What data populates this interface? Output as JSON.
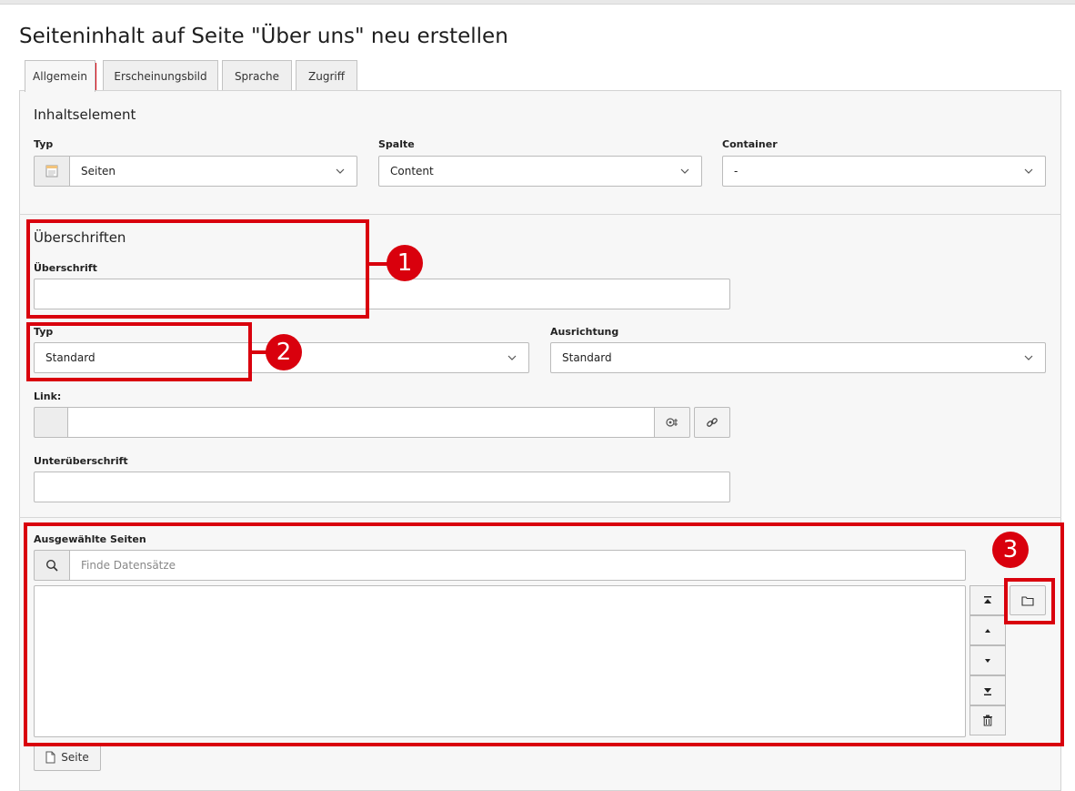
{
  "page": {
    "title": "Seiteninhalt auf Seite \"Über uns\" neu erstellen"
  },
  "tabs": [
    {
      "label": "Allgemein",
      "active": true
    },
    {
      "label": "Erscheinungsbild",
      "active": false
    },
    {
      "label": "Sprache",
      "active": false
    },
    {
      "label": "Zugriff",
      "active": false
    }
  ],
  "content_element": {
    "section_title": "Inhaltselement",
    "type": {
      "label": "Typ",
      "value": "Seiten",
      "icon": "page-type-icon"
    },
    "column": {
      "label": "Spalte",
      "value": "Content"
    },
    "container": {
      "label": "Container",
      "value": "-"
    }
  },
  "headings": {
    "section_title": "Überschriften",
    "heading": {
      "label": "Überschrift",
      "value": ""
    },
    "type": {
      "label": "Typ",
      "value": "Standard"
    },
    "alignment": {
      "label": "Ausrichtung",
      "value": "Standard"
    },
    "link": {
      "label": "Link:",
      "value": ""
    },
    "subheading": {
      "label": "Unterüberschrift",
      "value": ""
    }
  },
  "selected_pages": {
    "label": "Ausgewählte Seiten",
    "search_placeholder": "Finde Datensätze",
    "add_page_label": "Seite"
  },
  "annotations": [
    {
      "number": "1"
    },
    {
      "number": "2"
    },
    {
      "number": "3"
    }
  ],
  "colors": {
    "highlight": "#d9000d",
    "panel_bg": "#f7f7f7",
    "border": "#bbbbbb"
  }
}
